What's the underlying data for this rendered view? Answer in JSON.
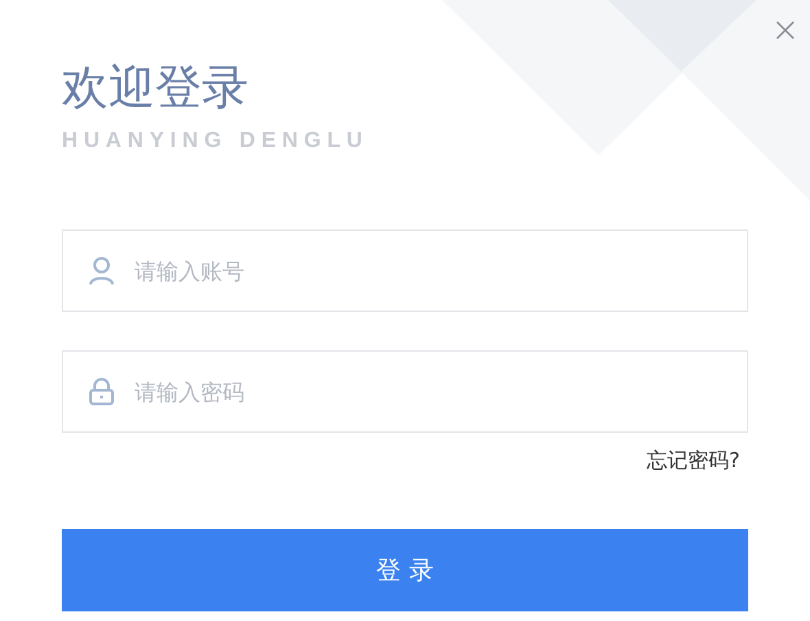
{
  "title": "欢迎登录",
  "subtitle": "HUANYING DENGLU",
  "fields": [
    {
      "kind": "user",
      "placeholder": "请输入账号"
    },
    {
      "kind": "lock",
      "placeholder": "请输入密码"
    }
  ],
  "forgot_link": "忘记密码?",
  "submit_button": "登 录"
}
